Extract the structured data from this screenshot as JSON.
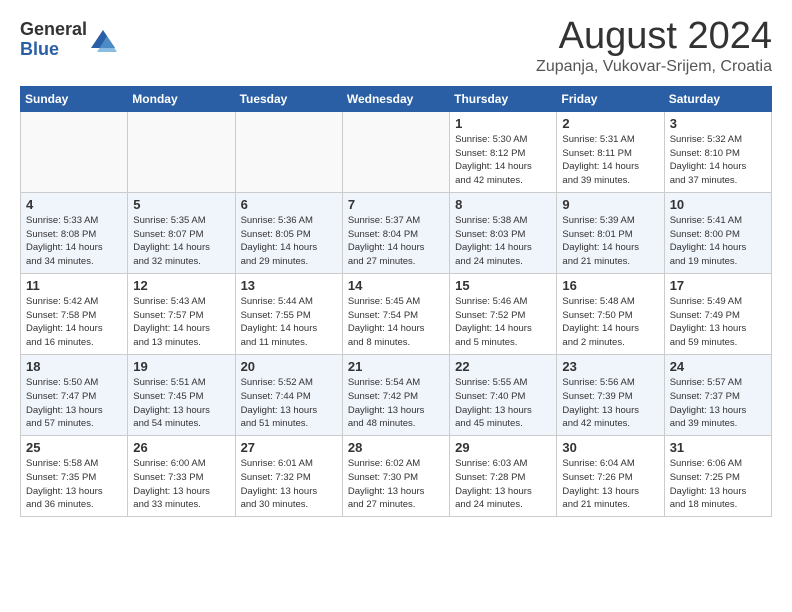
{
  "header": {
    "logo_general": "General",
    "logo_blue": "Blue",
    "month_title": "August 2024",
    "location": "Zupanja, Vukovar-Srijem, Croatia"
  },
  "weekdays": [
    "Sunday",
    "Monday",
    "Tuesday",
    "Wednesday",
    "Thursday",
    "Friday",
    "Saturday"
  ],
  "weeks": [
    [
      {
        "day": "",
        "info": ""
      },
      {
        "day": "",
        "info": ""
      },
      {
        "day": "",
        "info": ""
      },
      {
        "day": "",
        "info": ""
      },
      {
        "day": "1",
        "info": "Sunrise: 5:30 AM\nSunset: 8:12 PM\nDaylight: 14 hours\nand 42 minutes."
      },
      {
        "day": "2",
        "info": "Sunrise: 5:31 AM\nSunset: 8:11 PM\nDaylight: 14 hours\nand 39 minutes."
      },
      {
        "day": "3",
        "info": "Sunrise: 5:32 AM\nSunset: 8:10 PM\nDaylight: 14 hours\nand 37 minutes."
      }
    ],
    [
      {
        "day": "4",
        "info": "Sunrise: 5:33 AM\nSunset: 8:08 PM\nDaylight: 14 hours\nand 34 minutes."
      },
      {
        "day": "5",
        "info": "Sunrise: 5:35 AM\nSunset: 8:07 PM\nDaylight: 14 hours\nand 32 minutes."
      },
      {
        "day": "6",
        "info": "Sunrise: 5:36 AM\nSunset: 8:05 PM\nDaylight: 14 hours\nand 29 minutes."
      },
      {
        "day": "7",
        "info": "Sunrise: 5:37 AM\nSunset: 8:04 PM\nDaylight: 14 hours\nand 27 minutes."
      },
      {
        "day": "8",
        "info": "Sunrise: 5:38 AM\nSunset: 8:03 PM\nDaylight: 14 hours\nand 24 minutes."
      },
      {
        "day": "9",
        "info": "Sunrise: 5:39 AM\nSunset: 8:01 PM\nDaylight: 14 hours\nand 21 minutes."
      },
      {
        "day": "10",
        "info": "Sunrise: 5:41 AM\nSunset: 8:00 PM\nDaylight: 14 hours\nand 19 minutes."
      }
    ],
    [
      {
        "day": "11",
        "info": "Sunrise: 5:42 AM\nSunset: 7:58 PM\nDaylight: 14 hours\nand 16 minutes."
      },
      {
        "day": "12",
        "info": "Sunrise: 5:43 AM\nSunset: 7:57 PM\nDaylight: 14 hours\nand 13 minutes."
      },
      {
        "day": "13",
        "info": "Sunrise: 5:44 AM\nSunset: 7:55 PM\nDaylight: 14 hours\nand 11 minutes."
      },
      {
        "day": "14",
        "info": "Sunrise: 5:45 AM\nSunset: 7:54 PM\nDaylight: 14 hours\nand 8 minutes."
      },
      {
        "day": "15",
        "info": "Sunrise: 5:46 AM\nSunset: 7:52 PM\nDaylight: 14 hours\nand 5 minutes."
      },
      {
        "day": "16",
        "info": "Sunrise: 5:48 AM\nSunset: 7:50 PM\nDaylight: 14 hours\nand 2 minutes."
      },
      {
        "day": "17",
        "info": "Sunrise: 5:49 AM\nSunset: 7:49 PM\nDaylight: 13 hours\nand 59 minutes."
      }
    ],
    [
      {
        "day": "18",
        "info": "Sunrise: 5:50 AM\nSunset: 7:47 PM\nDaylight: 13 hours\nand 57 minutes."
      },
      {
        "day": "19",
        "info": "Sunrise: 5:51 AM\nSunset: 7:45 PM\nDaylight: 13 hours\nand 54 minutes."
      },
      {
        "day": "20",
        "info": "Sunrise: 5:52 AM\nSunset: 7:44 PM\nDaylight: 13 hours\nand 51 minutes."
      },
      {
        "day": "21",
        "info": "Sunrise: 5:54 AM\nSunset: 7:42 PM\nDaylight: 13 hours\nand 48 minutes."
      },
      {
        "day": "22",
        "info": "Sunrise: 5:55 AM\nSunset: 7:40 PM\nDaylight: 13 hours\nand 45 minutes."
      },
      {
        "day": "23",
        "info": "Sunrise: 5:56 AM\nSunset: 7:39 PM\nDaylight: 13 hours\nand 42 minutes."
      },
      {
        "day": "24",
        "info": "Sunrise: 5:57 AM\nSunset: 7:37 PM\nDaylight: 13 hours\nand 39 minutes."
      }
    ],
    [
      {
        "day": "25",
        "info": "Sunrise: 5:58 AM\nSunset: 7:35 PM\nDaylight: 13 hours\nand 36 minutes."
      },
      {
        "day": "26",
        "info": "Sunrise: 6:00 AM\nSunset: 7:33 PM\nDaylight: 13 hours\nand 33 minutes."
      },
      {
        "day": "27",
        "info": "Sunrise: 6:01 AM\nSunset: 7:32 PM\nDaylight: 13 hours\nand 30 minutes."
      },
      {
        "day": "28",
        "info": "Sunrise: 6:02 AM\nSunset: 7:30 PM\nDaylight: 13 hours\nand 27 minutes."
      },
      {
        "day": "29",
        "info": "Sunrise: 6:03 AM\nSunset: 7:28 PM\nDaylight: 13 hours\nand 24 minutes."
      },
      {
        "day": "30",
        "info": "Sunrise: 6:04 AM\nSunset: 7:26 PM\nDaylight: 13 hours\nand 21 minutes."
      },
      {
        "day": "31",
        "info": "Sunrise: 6:06 AM\nSunset: 7:25 PM\nDaylight: 13 hours\nand 18 minutes."
      }
    ]
  ]
}
